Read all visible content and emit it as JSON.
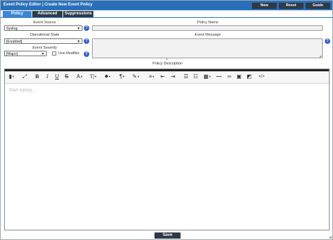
{
  "window": {
    "title": "Event Policy Editor | Create New Event Policy",
    "buttons": {
      "new": "New",
      "reset": "Reset",
      "guide": "Guide"
    }
  },
  "tabs": [
    {
      "label": "Policy",
      "active": true
    },
    {
      "label": "Advanced",
      "active": false
    },
    {
      "label": "Suppressions",
      "active": false
    }
  ],
  "form": {
    "event_source": {
      "label": "Event Source",
      "value": "Syslog"
    },
    "operational_state": {
      "label": "Operational State",
      "value": "[Enabled]"
    },
    "event_severity": {
      "label": "Event Severity",
      "value": "[Major]"
    },
    "use_modifier": {
      "label": "Use Modifier",
      "checked": false
    },
    "policy_name": {
      "label": "Policy Name",
      "value": ""
    },
    "event_message": {
      "label": "Event Message",
      "value": ""
    },
    "policy_description": {
      "label": "Policy Description"
    }
  },
  "editor": {
    "placeholder": "Start typing ...",
    "tools": [
      "file-icon",
      "fullscreen-icon",
      "bold-icon",
      "italic-icon",
      "underline-icon",
      "strikethrough-icon",
      "font-color-icon",
      "font-size-icon",
      "highlight-icon",
      "paragraph-icon",
      "clear-format-icon",
      "align-icon",
      "indent-decrease-icon",
      "indent-increase-icon",
      "ordered-list-icon",
      "unordered-list-icon",
      "table-icon",
      "horizontal-rule-icon",
      "link-icon",
      "image-icon",
      "eraser-icon",
      "code-icon"
    ]
  },
  "footer": {
    "save": "Save"
  },
  "colors": {
    "titlebar": "#2a70b8",
    "active_tab": "#3a86d4",
    "dark_button": "#2e3a46",
    "help_icon": "#3a5fc8"
  }
}
